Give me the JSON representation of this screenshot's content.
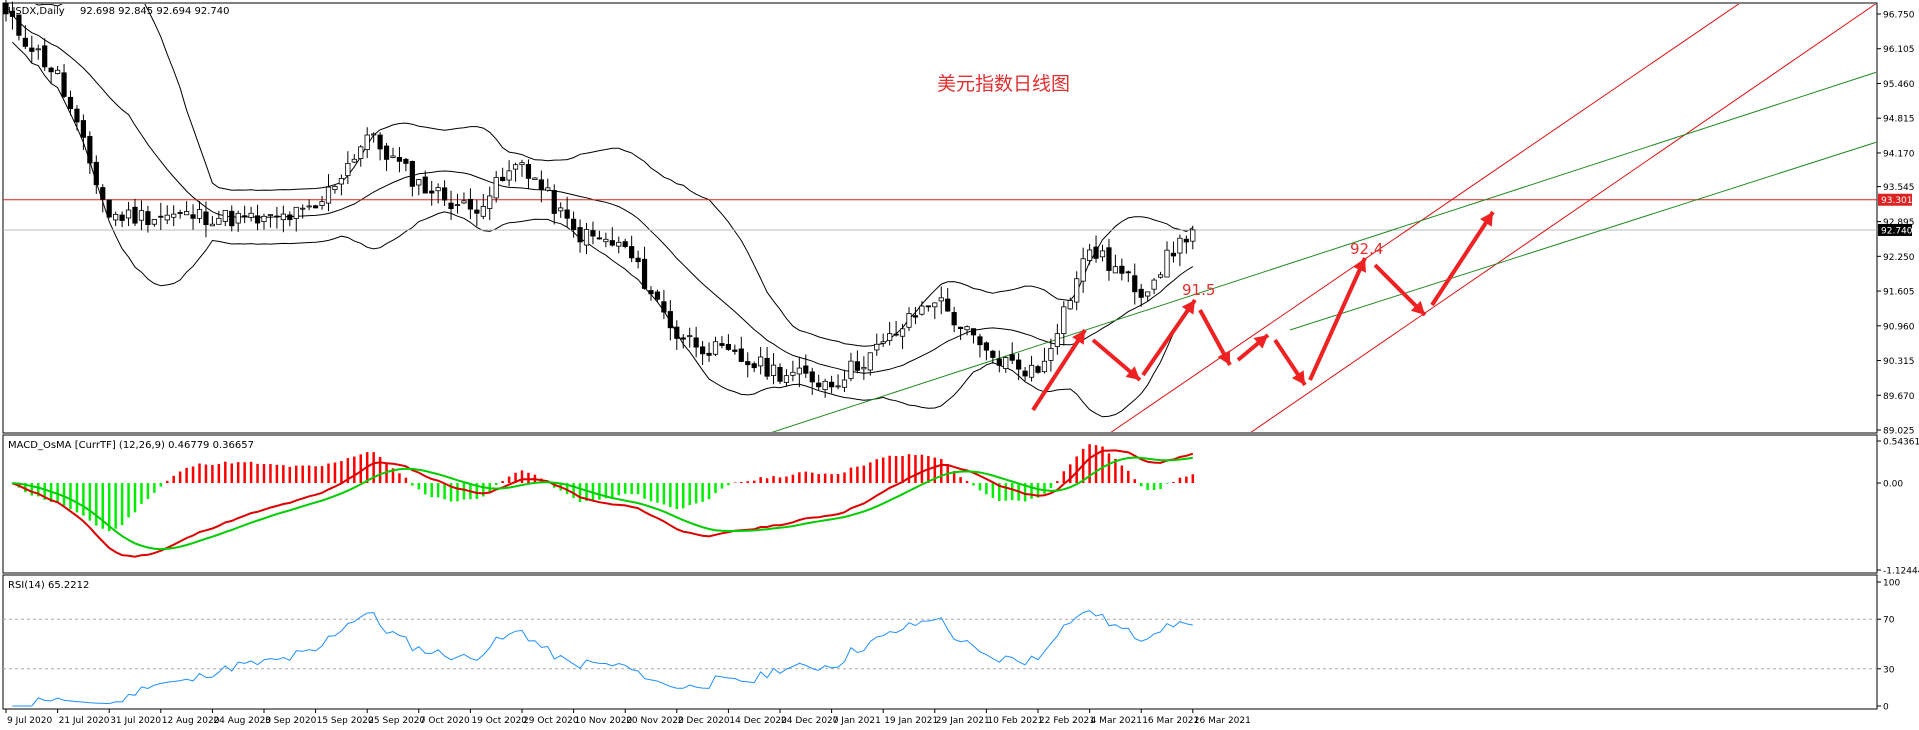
{
  "main_panel": {
    "symbol_label": "USDX,Daily",
    "ohlc_label": "92.698 92.845 92.694 92.740",
    "annotation_title": "美元指数日线图",
    "peak_labels": [
      "91.5",
      "92.4"
    ],
    "hline_price_tag": "93.301",
    "last_price_tag": "92.740",
    "y_ticks": [
      "96.750",
      "96.105",
      "95.460",
      "94.815",
      "94.170",
      "93.545",
      "92.895",
      "92.250",
      "91.605",
      "90.960",
      "90.315",
      "89.670",
      "89.025"
    ]
  },
  "macd_panel": {
    "label": "MACD_OsMA [CurrTF] (12,26,9) 0.46779 0.36657",
    "y_ticks": [
      "0.54361",
      "0.00",
      "-1.12444"
    ]
  },
  "rsi_panel": {
    "label": "RSI(14) 65.2212",
    "y_ticks": [
      "100",
      "70",
      "30",
      "0"
    ]
  },
  "x_axis": {
    "labels": [
      "9 Jul 2020",
      "21 Jul 2020",
      "31 Jul 2020",
      "12 Aug 2020",
      "24 Aug 2020",
      "3 Sep 2020",
      "15 Sep 2020",
      "25 Sep 2020",
      "7 Oct 2020",
      "19 Oct 2020",
      "29 Oct 2020",
      "10 Nov 2020",
      "20 Nov 2020",
      "2 Dec 2020",
      "14 Dec 2020",
      "24 Dec 2020",
      "7 Jan 2021",
      "19 Jan 2021",
      "29 Jan 2021",
      "10 Feb 2021",
      "22 Feb 2021",
      "4 Mar 2021",
      "16 Mar 2021",
      "26 Mar 2021"
    ]
  },
  "colors": {
    "bull_candle": "#ffffff",
    "bear_candle": "#000000",
    "macd_positive": "#ff0000",
    "macd_negative": "#00ee00",
    "macd_line": "#dd0000",
    "signal_line": "#00cc00",
    "rsi_line": "#1e90ff",
    "channel_red": "#dd1111",
    "channel_green": "#228b22",
    "arrow": "#ee2222"
  },
  "chart_data": {
    "type": "candlestick",
    "symbol": "USDX",
    "timeframe": "Daily",
    "price_range": [
      89.025,
      96.75
    ],
    "horizontal_level": 93.301,
    "last_close": 92.74,
    "anchors": [
      {
        "date": "9 Jul 2020",
        "close": 96.7
      },
      {
        "date": "21 Jul 2020",
        "close": 95.6
      },
      {
        "date": "31 Jul 2020",
        "close": 93.0
      },
      {
        "date": "12 Aug 2020",
        "close": 93.0
      },
      {
        "date": "24 Aug 2020",
        "close": 93.0
      },
      {
        "date": "3 Sep 2020",
        "close": 92.9
      },
      {
        "date": "15 Sep 2020",
        "close": 93.1
      },
      {
        "date": "25 Sep 2020",
        "close": 94.5
      },
      {
        "date": "7 Oct 2020",
        "close": 93.6
      },
      {
        "date": "19 Oct 2020",
        "close": 93.1
      },
      {
        "date": "29 Oct 2020",
        "close": 94.0
      },
      {
        "date": "10 Nov 2020",
        "close": 92.7
      },
      {
        "date": "20 Nov 2020",
        "close": 92.4
      },
      {
        "date": "2 Dec 2020",
        "close": 90.8
      },
      {
        "date": "14 Dec 2020",
        "close": 90.4
      },
      {
        "date": "24 Dec 2020",
        "close": 90.1
      },
      {
        "date": "7 Jan 2021",
        "close": 89.9
      },
      {
        "date": "19 Jan 2021",
        "close": 90.6
      },
      {
        "date": "29 Jan 2021",
        "close": 91.5
      },
      {
        "date": "10 Feb 2021",
        "close": 90.4
      },
      {
        "date": "22 Feb 2021",
        "close": 90.1
      },
      {
        "date": "4 Mar 2021",
        "close": 92.4
      },
      {
        "date": "16 Mar 2021",
        "close": 91.6
      },
      {
        "date": "26 Mar 2021",
        "close": 92.8
      }
    ],
    "macd": {
      "osma": 0.46779,
      "signal": 0.36657,
      "range": [
        -1.12444,
        0.54361
      ]
    },
    "rsi": {
      "period": 14,
      "value": 65.2212,
      "levels": [
        30,
        70
      ]
    }
  }
}
